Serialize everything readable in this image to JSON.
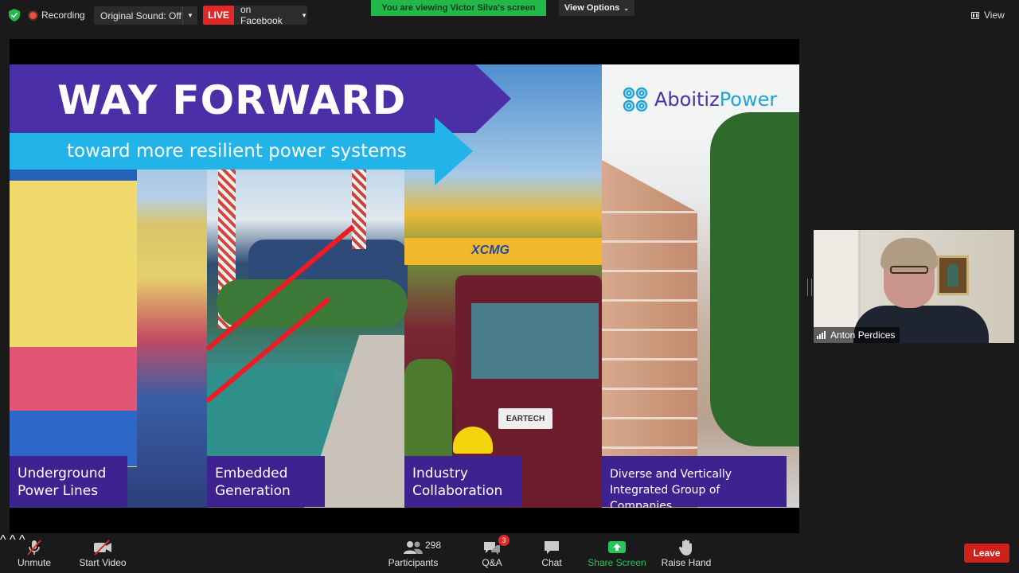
{
  "topbar": {
    "recording_label": "Recording",
    "original_sound": "Original Sound: Off",
    "live_badge": "LIVE",
    "live_target": "on Facebook",
    "viewing_banner": "You are viewing Victor Silva's screen",
    "view_options": "View Options",
    "view_label": "View"
  },
  "slide": {
    "title": "WAY FORWARD",
    "subtitle": "toward more resilient power systems",
    "logo_part1": "Aboitiz",
    "logo_part2": "Power",
    "crane_text": "XCMG",
    "truck_sign": "EARTECH",
    "captions": [
      {
        "line1": "Underground",
        "line2": "Power Lines"
      },
      {
        "line1": "Embedded",
        "line2": "Generation"
      },
      {
        "line1": "Industry",
        "line2": "Collaboration"
      },
      {
        "line1": "Diverse and Vertically",
        "line2": "Integrated Group of Companies"
      }
    ],
    "colors": {
      "purple": "#4a2fa7",
      "cyan": "#22b3e8",
      "caption_bg": "#3d2290"
    }
  },
  "participant": {
    "name": "Anton Perdices"
  },
  "toolbar": {
    "unmute": "Unmute",
    "start_video": "Start Video",
    "participants": "Participants",
    "participant_count": "298",
    "qa": "Q&A",
    "qa_badge": "3",
    "chat": "Chat",
    "share_screen": "Share Screen",
    "raise_hand": "Raise Hand",
    "leave": "Leave"
  },
  "icons": [
    "shield-icon",
    "recording-dot-icon",
    "caret-down-icon",
    "view-grid-icon",
    "microphone-muted-icon",
    "video-off-icon",
    "participants-icon",
    "qa-icon",
    "chat-icon",
    "share-screen-icon",
    "raise-hand-icon",
    "signal-bars-icon"
  ]
}
